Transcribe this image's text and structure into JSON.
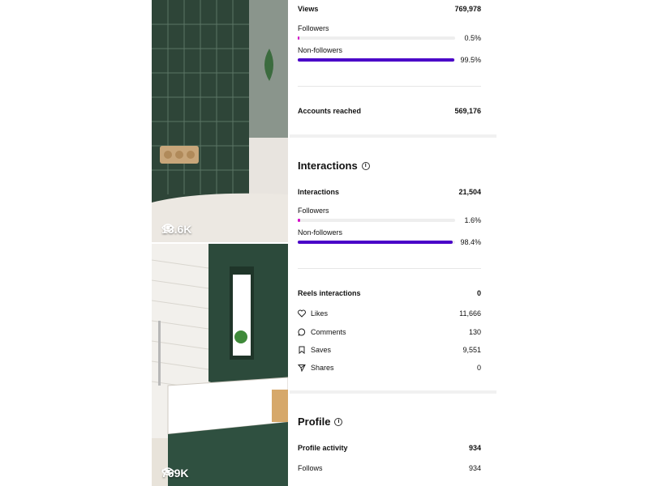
{
  "thumbnails": [
    {
      "views": "13.6K"
    },
    {
      "views": "769K"
    }
  ],
  "views": {
    "label": "Views",
    "value": "769,978",
    "followers": {
      "label": "Followers",
      "pct": "0.5%",
      "fraction": 0.005
    },
    "non_followers": {
      "label": "Non-followers",
      "pct": "99.5%",
      "fraction": 0.995
    }
  },
  "accounts_reached": {
    "label": "Accounts reached",
    "value": "569,176"
  },
  "interactions_section": {
    "title": "Interactions",
    "label": "Interactions",
    "value": "21,504",
    "followers": {
      "label": "Followers",
      "pct": "1.6%",
      "fraction": 0.016
    },
    "non_followers": {
      "label": "Non-followers",
      "pct": "98.4%",
      "fraction": 0.984
    }
  },
  "reels_interactions": {
    "label": "Reels interactions",
    "value": "0",
    "items": [
      {
        "icon": "heart-icon",
        "label": "Likes",
        "value": "11,666"
      },
      {
        "icon": "comment-icon",
        "label": "Comments",
        "value": "130"
      },
      {
        "icon": "bookmark-icon",
        "label": "Saves",
        "value": "9,551"
      },
      {
        "icon": "send-icon",
        "label": "Shares",
        "value": "0"
      }
    ]
  },
  "profile_section": {
    "title": "Profile",
    "activity": {
      "label": "Profile activity",
      "value": "934"
    },
    "follows": {
      "label": "Follows",
      "value": "934"
    }
  },
  "colors": {
    "follower_bar": "#d400c8",
    "non_follower_bar": "#4a00c8"
  }
}
